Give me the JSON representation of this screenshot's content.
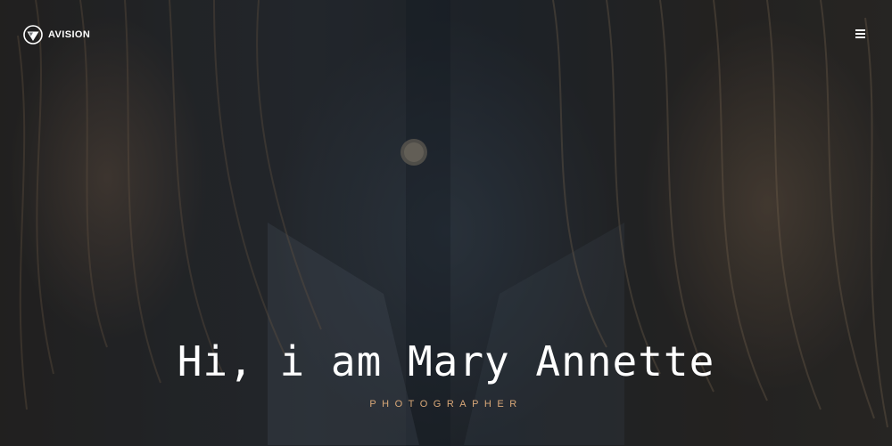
{
  "header": {
    "brand_name": "AVISION",
    "brand_icon": "triangle-circle-logo-icon",
    "menu_icon": "hamburger-menu-icon"
  },
  "hero": {
    "title": "Hi, i am Mary Annette",
    "subtitle": "PHOTOGRAPHER",
    "background_image": "woman-hair-denim-shirt-photo"
  },
  "colors": {
    "accent": "#d9a878",
    "text": "#ffffff",
    "overlay": "#0f1216"
  }
}
